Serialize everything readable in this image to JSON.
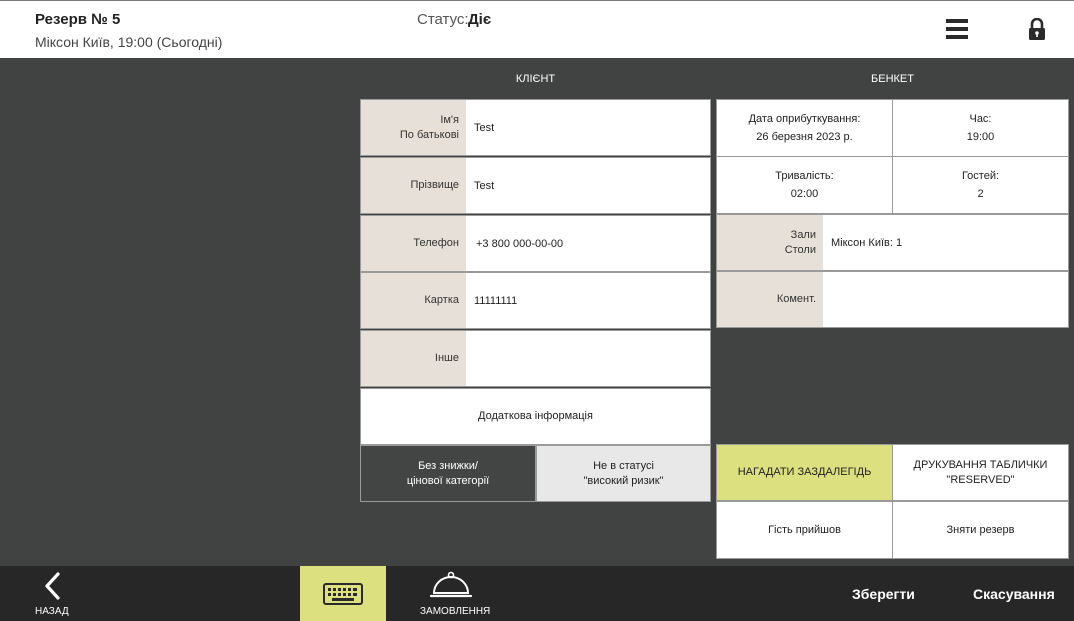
{
  "header": {
    "title": "Резерв № 5",
    "subtitle": "Міксон Київ, 19:00 (Сьогодні)",
    "status_label": "Статус:",
    "status_value": "Діє",
    "menu_icon": "hamburger-menu-icon",
    "lock_icon": "lock-icon"
  },
  "client": {
    "title": "КЛІЄНТ",
    "name_label_1": "Ім'я",
    "name_label_2": "По батькові",
    "name_value": "Test",
    "surname_label": "Прізвище",
    "surname_value": "Test",
    "phone_label": "Телефон",
    "phone_value": "+3 800 000-00-00",
    "card_label": "Картка",
    "card_value": "11111111",
    "other_label": "Інше",
    "other_value": "",
    "extra_info": "Додаткова інформація",
    "no_discount_1": "Без знижки/",
    "no_discount_2": "цінової категорії",
    "not_high_risk_1": "Не в статусі",
    "not_high_risk_2": "\"високий ризик\""
  },
  "banquet": {
    "title": "БЕНКЕТ",
    "booking_date_label": "Дата оприбуткування:",
    "booking_date_value": "26 березня 2023 р.",
    "time_label": "Час:",
    "time_value": "19:00",
    "duration_label": "Тривалість:",
    "duration_value": "02:00",
    "guests_label": "Гостей:",
    "guests_value": "2",
    "halls_label_1": "Зали",
    "halls_label_2": "Столи",
    "halls_value": "Міксон Київ: 1",
    "comment_label": "Комент.",
    "comment_value": "",
    "remind_btn": "НАГАДАТИ ЗАЗДАЛЕГІДЬ",
    "print_btn_1": "ДРУКУВАННЯ ТАБЛИЧКИ",
    "print_btn_2": "\"RESERVED\"",
    "guest_arrived_btn": "Гість прийшов",
    "remove_reserve_btn": "Зняти резерв"
  },
  "footer": {
    "back_label": "НАЗАД",
    "order_label": "ЗАМОВЛЕННЯ",
    "save_label": "Зберегти",
    "cancel_label": "Скасування",
    "back_icon": "chevron-left-icon",
    "keyboard_icon": "keyboard-icon",
    "order_icon": "cloche-icon"
  },
  "colors": {
    "accent_yellow": "#dde07f",
    "label_beige": "#e7e0d8",
    "background_dark": "#414342",
    "footer_dark": "#272727"
  }
}
